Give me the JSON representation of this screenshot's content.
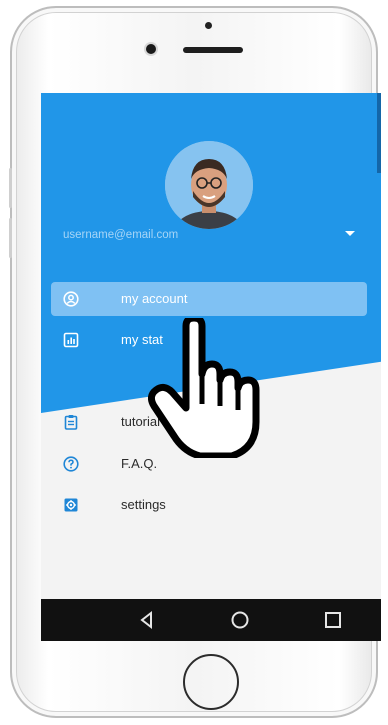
{
  "profile": {
    "email": "username@email.com"
  },
  "menu": {
    "items": [
      {
        "label": "my account",
        "icon": "user-circle-icon"
      },
      {
        "label": "my stat",
        "icon": "bar-chart-icon"
      },
      {
        "label": "tutorial",
        "icon": "clipboard-icon"
      },
      {
        "label": "F.A.Q.",
        "icon": "question-circle-icon"
      },
      {
        "label": "settings",
        "icon": "gear-icon"
      }
    ]
  },
  "navbar": {
    "icons": [
      "back-icon",
      "home-icon",
      "recents-icon"
    ]
  },
  "colors": {
    "header_blue": "#2196e8",
    "highlight_blue": "#7fc1f3",
    "light_bg": "#f3f3f3",
    "navbar": "#111111"
  }
}
